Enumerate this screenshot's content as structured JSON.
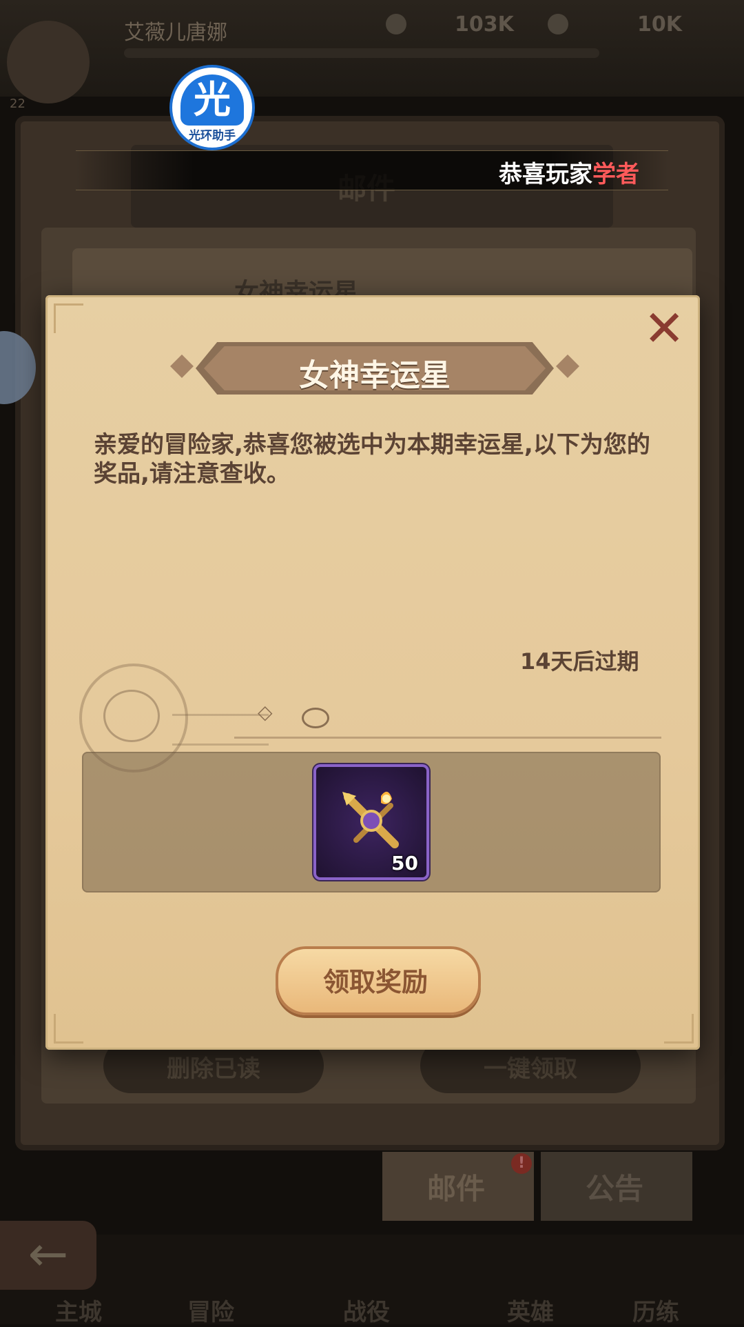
{
  "background": {
    "player_name": "艾薇儿唐娜",
    "stat_1": "103K",
    "stat_2": "10K",
    "level": "22",
    "mail_panel_title": "邮件",
    "mail_item_title": "女神幸运星",
    "delete_read_label": "删除已读",
    "claim_all_label": "一键领取",
    "tabs": [
      {
        "label": "邮件",
        "badge": "!"
      },
      {
        "label": "公告"
      }
    ],
    "nav_items": [
      "主城",
      "冒险",
      "战役",
      "英雄",
      "历练"
    ]
  },
  "overlay": {
    "badge_glyph": "光",
    "badge_text": "光环助手",
    "marquee_prefix": "恭喜玩家",
    "marquee_highlight": "学者"
  },
  "letter": {
    "title": "女神幸运星",
    "body": "亲爱的冒险家,恭喜您被选中为本期幸运星,以下为您的奖品,请注意查收。",
    "expire": "14天后过期",
    "reward": {
      "icon": "golden-crossbow-icon",
      "count": "50"
    },
    "claim_label": "领取奖励",
    "close_icon": "close-x-icon"
  },
  "colors": {
    "parchment": "#e5c99b",
    "text_brown": "#5b4334",
    "item_frame": "#8a63c8",
    "marquee_highlight": "#ff5a5a"
  }
}
